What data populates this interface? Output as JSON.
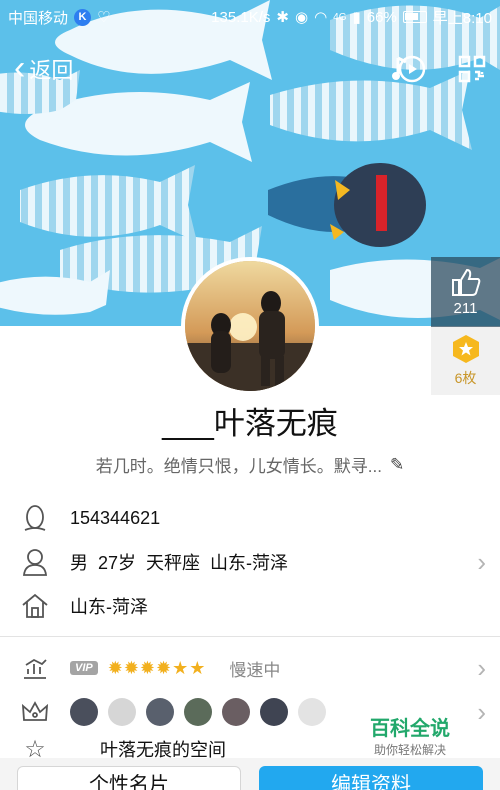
{
  "status_bar": {
    "carrier": "中国移动",
    "carrier_badge": "K",
    "speed": "135.1K/s",
    "signal": "4G",
    "battery": "66%",
    "time": "早上8:10"
  },
  "nav": {
    "back_label": "返回",
    "icons": [
      "music-note-icon",
      "qr-code-icon"
    ]
  },
  "like": {
    "count": "211"
  },
  "medal": {
    "count": "6枚"
  },
  "profile": {
    "nickname": "___叶落无痕",
    "signature": "若几时。绝情只恨，儿女情长。默寻..."
  },
  "info": {
    "qq_number": "154344621",
    "gender": "男",
    "age": "27岁",
    "zodiac": "天秤座",
    "location": "山东-菏泽",
    "hometown": "山东-菏泽"
  },
  "level": {
    "vip_label": "VIP",
    "status": "慢速中"
  },
  "space": {
    "label": "___叶落无痕的空间"
  },
  "watermark": {
    "title": "百科全说",
    "subtitle": "助你轻松解决"
  },
  "buttons": {
    "card": "个性名片",
    "edit": "编辑资料"
  },
  "colors": {
    "banner_blue": "#5cc0ea",
    "fish_dark": "#2a6f9e",
    "accent_blue": "#22a8ef",
    "baike_green": "#22a86b"
  }
}
